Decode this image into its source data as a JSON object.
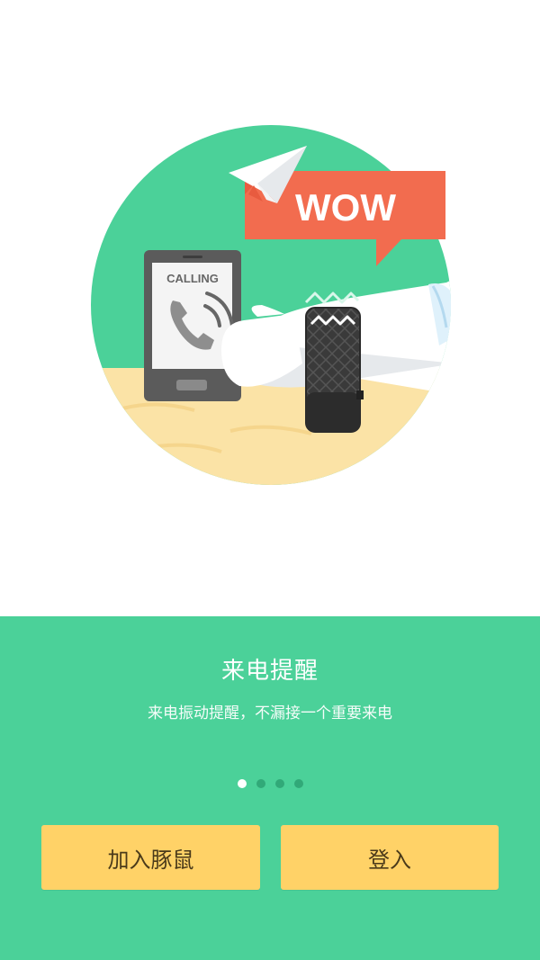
{
  "illustration": {
    "bubble_text": "WOW",
    "phone_screen_text": "CALLING"
  },
  "onboarding": {
    "title": "来电提醒",
    "subtitle": "来电振动提醒，不漏接一个重要来电",
    "pager": {
      "total": 4,
      "active_index": 0
    }
  },
  "actions": {
    "join_label": "加入豚鼠",
    "login_label": "登入"
  },
  "colors": {
    "accent_green": "#4bd199",
    "button_yellow": "#ffd267",
    "bubble_orange": "#f26c4f"
  }
}
